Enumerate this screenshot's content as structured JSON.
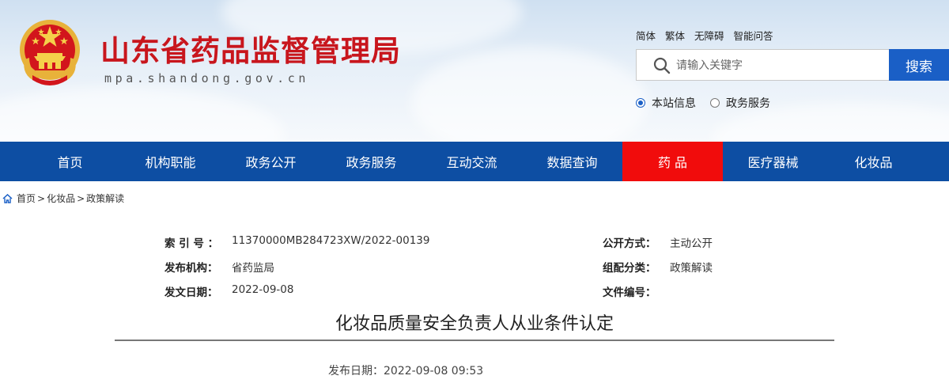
{
  "header": {
    "site_title": "山东省药品监督管理局",
    "site_url": "mpa.shandong.gov.cn",
    "emblem_icon": "national-emblem-icon",
    "top_links": [
      "简体",
      "繁体",
      "无障碍",
      "智能问答"
    ],
    "search": {
      "placeholder": "请输入关键字",
      "button_label": "搜索",
      "icon": "search-icon"
    },
    "search_scope": [
      {
        "label": "本站信息",
        "checked": true
      },
      {
        "label": "政务服务",
        "checked": false
      }
    ]
  },
  "nav": {
    "items": [
      "首页",
      "机构职能",
      "政务公开",
      "政务服务",
      "互动交流",
      "数据查询",
      "药 品",
      "医疗器械",
      "化妆品"
    ],
    "active_index": 6,
    "colors": {
      "bar": "#0d4ea3",
      "active": "#f10c0c"
    }
  },
  "breadcrumb": {
    "icon": "home-icon",
    "items": [
      "首页",
      "化妆品",
      "政策解读"
    ],
    "separator": ">"
  },
  "meta": {
    "left": [
      {
        "label": "索 引 号 ：",
        "value": "11370000MB284723XW/2022-00139"
      },
      {
        "label": "发布机构：",
        "value": "省药监局"
      },
      {
        "label": "发文日期：",
        "value": "2022-09-08"
      }
    ],
    "right": [
      {
        "label": "公开方式：",
        "value": "主动公开"
      },
      {
        "label": "组配分类：",
        "value": "政策解读"
      },
      {
        "label": "文件编号：",
        "value": ""
      }
    ]
  },
  "article": {
    "title": "化妆品质量安全负责人从业条件认定",
    "publish_date": "发布日期：2022-09-08 09:53"
  }
}
